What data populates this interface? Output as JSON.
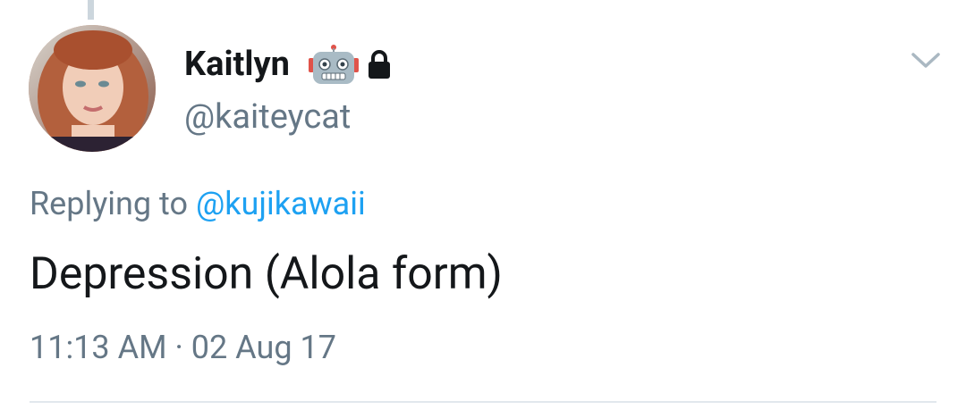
{
  "tweet": {
    "author": {
      "display_name": "Kaitlyn",
      "handle": "@kaiteycat",
      "name_icons": [
        "robot-icon",
        "lock-icon"
      ]
    },
    "reply": {
      "prefix": "Replying to",
      "mention": "@kujikawaii"
    },
    "text": "Depression (Alola form)",
    "timestamp": {
      "time": "11:13 AM",
      "separator": "·",
      "date": "02 Aug 17"
    }
  },
  "colors": {
    "primary_text": "#14171a",
    "secondary_text": "#657786",
    "link": "#1da1f2",
    "divider": "#e1e8ed",
    "thread_line": "#ccd6dd"
  }
}
